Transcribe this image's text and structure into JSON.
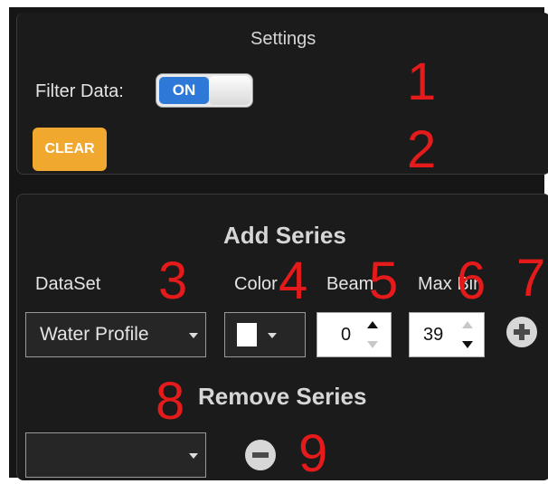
{
  "settings": {
    "title": "Settings",
    "filter_label": "Filter Data:",
    "toggle_state": "ON",
    "clear_label": "CLEAR"
  },
  "add_series": {
    "title": "Add Series",
    "dataset_label": "DataSet",
    "dataset_value": "Water Profile",
    "color_label": "Color",
    "color_value": "#ffffff",
    "beam_label": "Beam",
    "beam_value": "0",
    "maxbin_label": "Max Bin",
    "maxbin_value": "39"
  },
  "remove_series": {
    "title": "Remove Series",
    "selected_value": ""
  },
  "annotations": [
    "1",
    "2",
    "3",
    "4",
    "5",
    "6",
    "7",
    "8",
    "9"
  ],
  "colors": {
    "accent": "#2e79d8",
    "clear": "#f0a92e",
    "annotation": "#e51b1b"
  }
}
